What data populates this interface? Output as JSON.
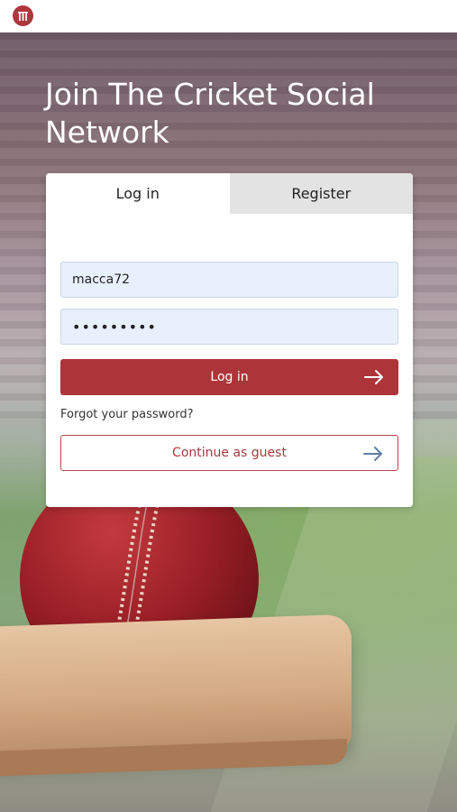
{
  "header": {
    "logo_icon": "cricket-stumps-icon",
    "brand_color": "#b0353c"
  },
  "hero": {
    "headline": "Join The Cricket Social Network"
  },
  "auth": {
    "tabs": [
      {
        "label": "Log in",
        "active": true
      },
      {
        "label": "Register",
        "active": false
      }
    ],
    "username_value": "macca72",
    "password_value": "•••••••••",
    "login_button_label": "Log in",
    "forgot_password_label": "Forgot your password?",
    "guest_button_label": "Continue as guest",
    "arrow_icon": "arrow-right-icon",
    "colors": {
      "primary": "#ad3539",
      "field_bg": "#e8f0fd",
      "guest_arrow": "#5f7fa3"
    }
  }
}
